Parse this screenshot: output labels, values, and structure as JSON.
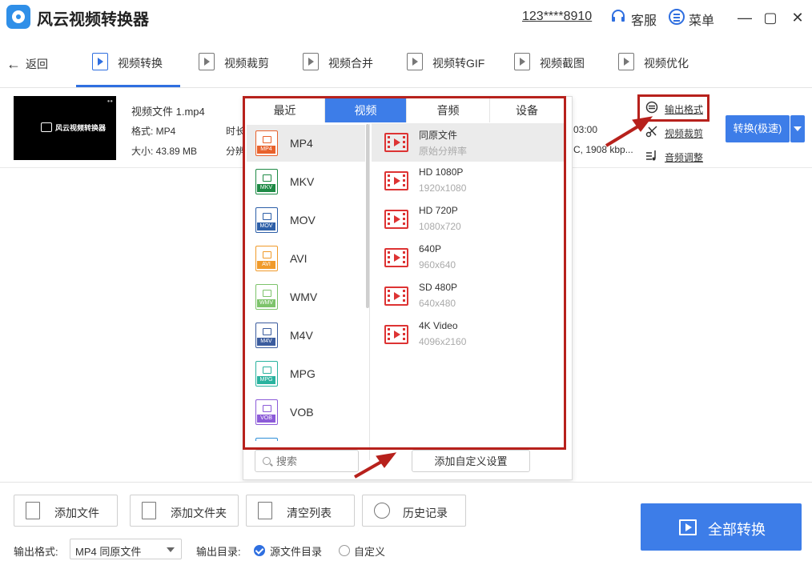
{
  "app": {
    "title": "风云视频转换器",
    "user_id": "123****8910",
    "support_label": "客服",
    "menu_label": "菜单",
    "window_controls": [
      "minimize-icon",
      "maximize-icon",
      "close-icon"
    ]
  },
  "nav": {
    "back_label": "返回",
    "tabs": [
      {
        "label": "视频转换",
        "active": true,
        "icon": "video-convert-icon"
      },
      {
        "label": "视频裁剪",
        "icon": "video-crop-icon"
      },
      {
        "label": "视频合并",
        "icon": "video-merge-icon"
      },
      {
        "label": "视频转GIF",
        "icon": "gif-icon"
      },
      {
        "label": "视频截图",
        "icon": "screenshot-icon"
      },
      {
        "label": "视频优化",
        "icon": "optimize-icon"
      }
    ]
  },
  "file": {
    "name": "视频文件 1.mp4",
    "format": "格式: MP4",
    "size": "大小: 43.89 MB",
    "duration_label": "时长",
    "resolution_label": "分辨",
    "right_duration": "03:00",
    "right_info": "C, 1908 kbp...",
    "thumbnail_text": "风云视频转换器"
  },
  "side_actions": {
    "output_format": "输出格式",
    "video_crop": "视频裁剪",
    "audio_adjust": "音频调整",
    "convert_btn": "转换(极速)"
  },
  "popup": {
    "categories": [
      "最近",
      "视频",
      "音频",
      "设备"
    ],
    "active_category": "视频",
    "formats": [
      {
        "name": "MP4",
        "tag": "MP4",
        "color": "#e8622c",
        "selected": true
      },
      {
        "name": "MKV",
        "tag": "MKV",
        "color": "#1e8a45"
      },
      {
        "name": "MOV",
        "tag": "MOV",
        "color": "#2d5fa8"
      },
      {
        "name": "AVI",
        "tag": "AVI",
        "color": "#f09a2a"
      },
      {
        "name": "WMV",
        "tag": "WMV",
        "color": "#7dc36b"
      },
      {
        "name": "M4V",
        "tag": "M4V",
        "color": "#3b5c9e"
      },
      {
        "name": "MPG",
        "tag": "MPG",
        "color": "#2ab39f"
      },
      {
        "name": "VOB",
        "tag": "VOB",
        "color": "#8c5bd8"
      }
    ],
    "resolutions": [
      {
        "name": "同原文件",
        "sub": "原始分辨率",
        "selected": true
      },
      {
        "name": "HD 1080P",
        "sub": "1920x1080"
      },
      {
        "name": "HD 720P",
        "sub": "1080x720"
      },
      {
        "name": "640P",
        "sub": "960x640"
      },
      {
        "name": "SD 480P",
        "sub": "640x480"
      },
      {
        "name": "4K Video",
        "sub": "4096x2160"
      }
    ],
    "search_placeholder": "搜索",
    "custom_btn": "添加自定义设置"
  },
  "bottom": {
    "buttons": [
      "添加文件",
      "添加文件夹",
      "清空列表",
      "历史记录"
    ],
    "output_format_label": "输出格式:",
    "output_format_value": "MP4 同原文件",
    "output_dir_label": "输出目录:",
    "dir_source": "源文件目录",
    "dir_custom": "自定义",
    "convert_all": "全部转换"
  },
  "colors": {
    "accent": "#3d7de8",
    "annotation": "#b7211c"
  }
}
